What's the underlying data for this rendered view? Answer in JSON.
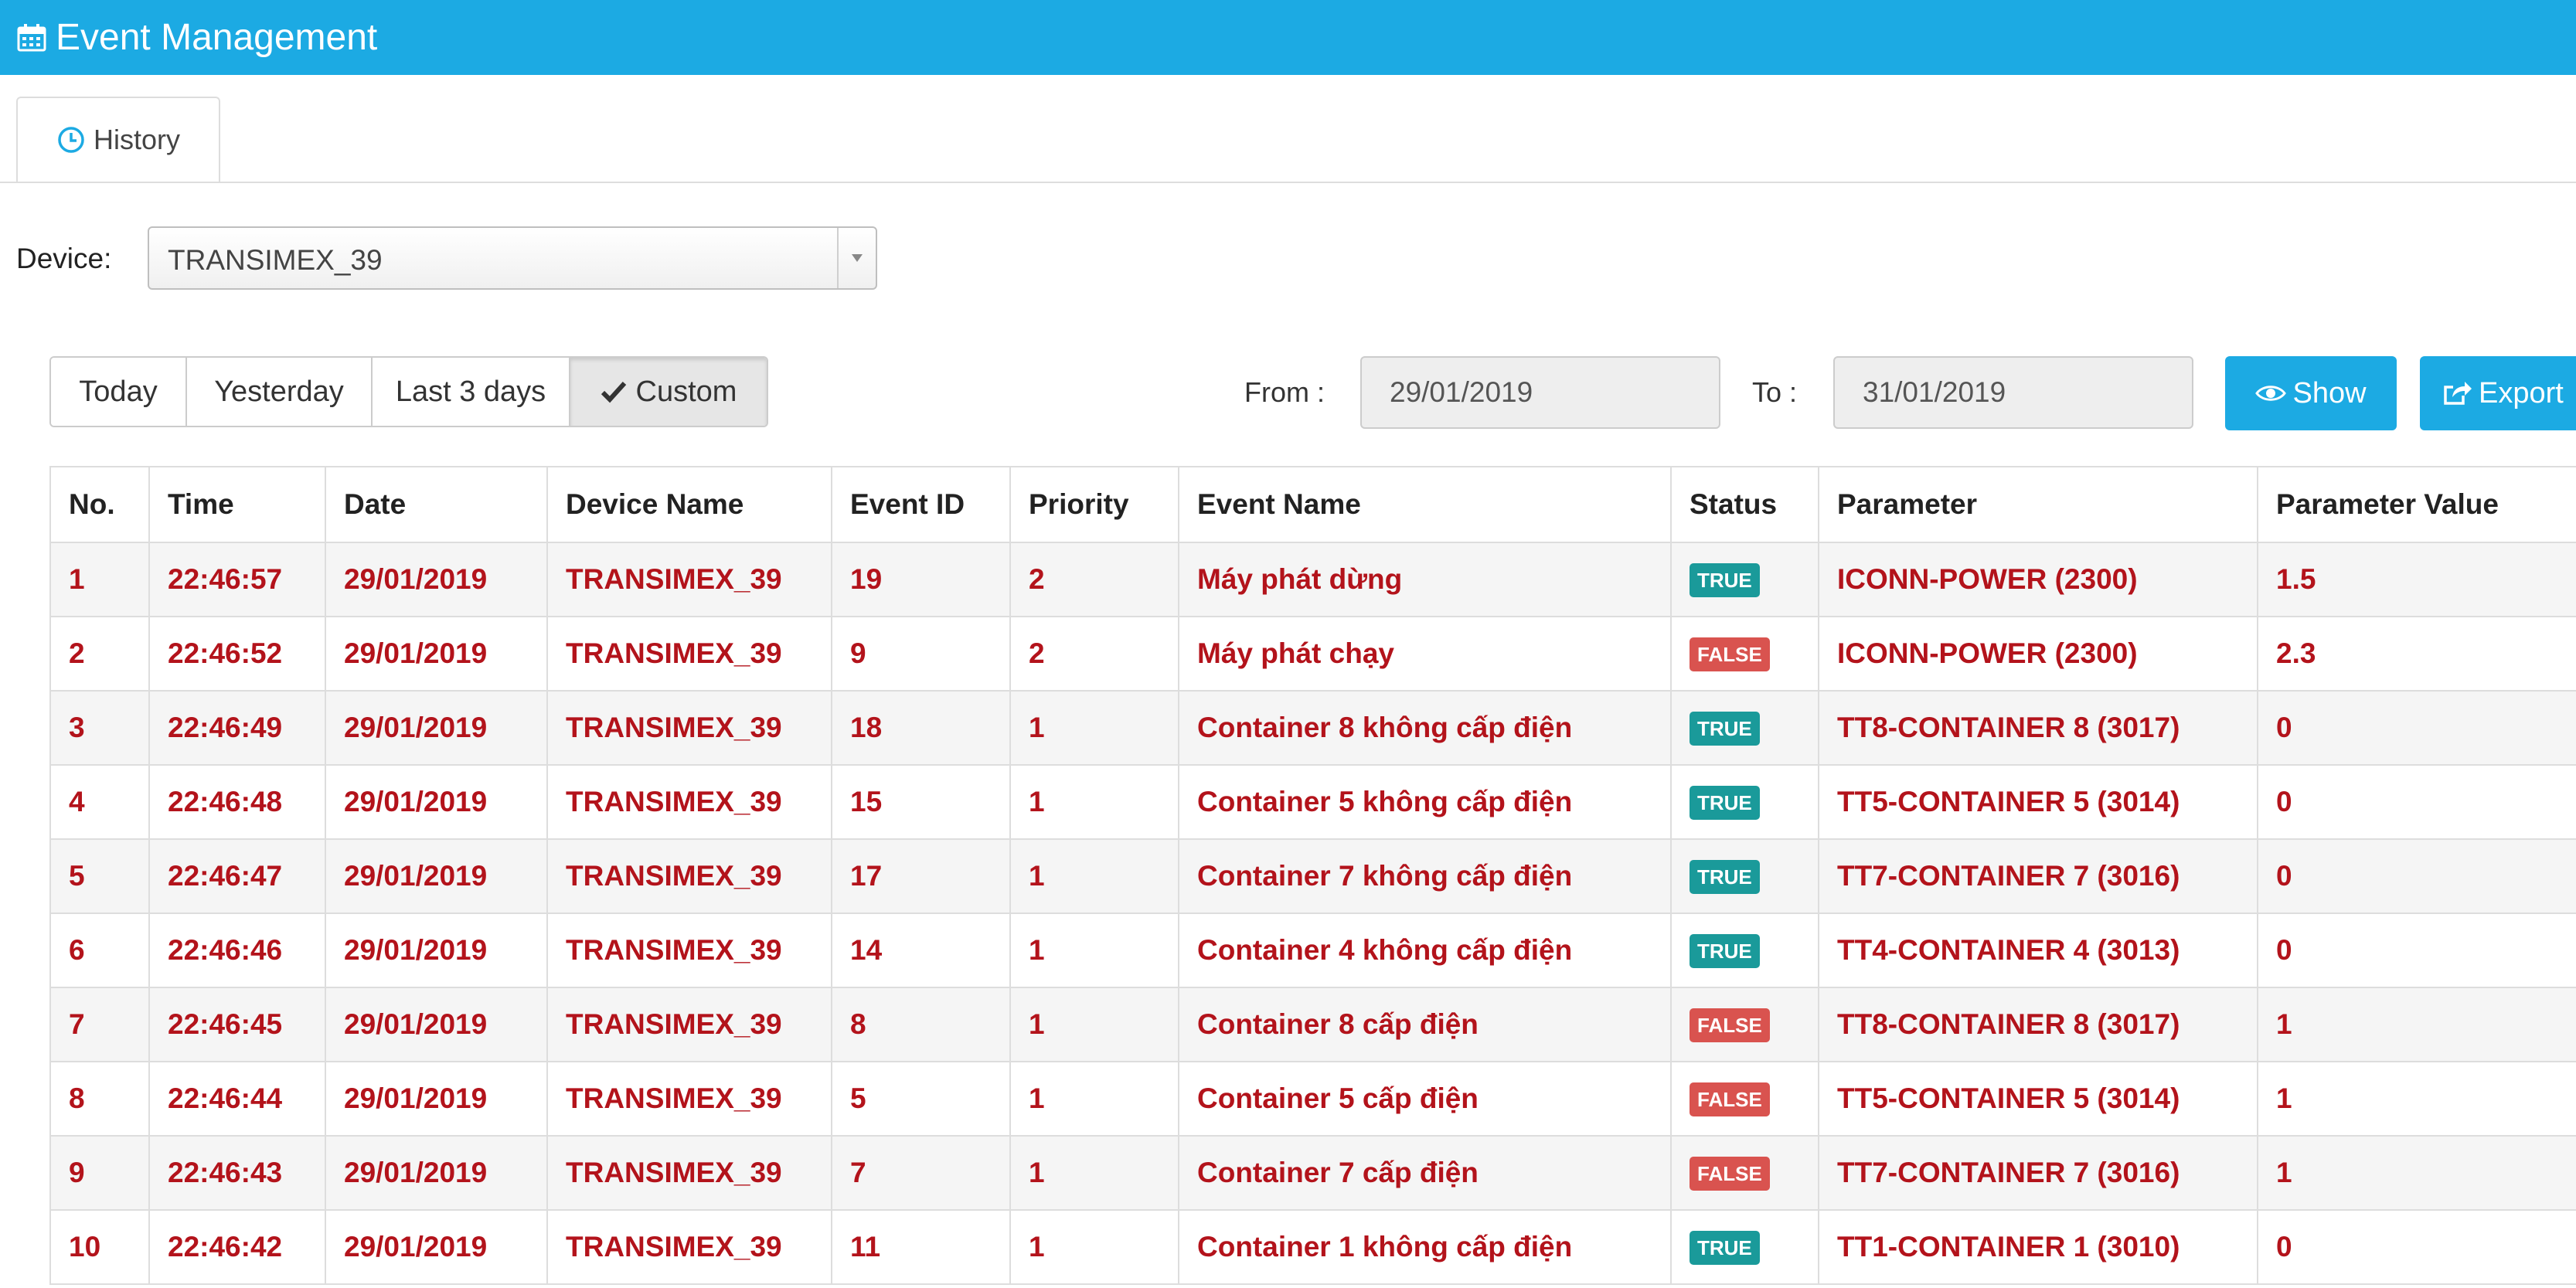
{
  "header": {
    "title": "Event Management",
    "icon": "calendar-icon"
  },
  "tabs": [
    {
      "label": "History",
      "icon": "clock-icon",
      "active": true
    }
  ],
  "device": {
    "label": "Device:",
    "selected": "TRANSIMEX_39"
  },
  "range_buttons": [
    {
      "label": "Today",
      "active": false
    },
    {
      "label": "Yesterday",
      "active": false
    },
    {
      "label": "Last 3 days",
      "active": false
    },
    {
      "label": "Custom",
      "active": true
    }
  ],
  "filter": {
    "from_label": "From :",
    "from_value": "29/01/2019",
    "to_label": "To :",
    "to_value": "31/01/2019",
    "show_label": "Show",
    "export_label": "Export"
  },
  "table": {
    "headers": [
      "No.",
      "Time",
      "Date",
      "Device Name",
      "Event ID",
      "Priority",
      "Event Name",
      "Status",
      "Parameter",
      "Parameter Value"
    ],
    "rows": [
      {
        "no": "1",
        "time": "22:46:57",
        "date": "29/01/2019",
        "device": "TRANSIMEX_39",
        "event_id": "19",
        "priority": "2",
        "event_name": "Máy phát dừng",
        "status": "TRUE",
        "parameter": "ICONN-POWER (2300)",
        "value": "1.5"
      },
      {
        "no": "2",
        "time": "22:46:52",
        "date": "29/01/2019",
        "device": "TRANSIMEX_39",
        "event_id": "9",
        "priority": "2",
        "event_name": "Máy phát chạy",
        "status": "FALSE",
        "parameter": "ICONN-POWER (2300)",
        "value": "2.3"
      },
      {
        "no": "3",
        "time": "22:46:49",
        "date": "29/01/2019",
        "device": "TRANSIMEX_39",
        "event_id": "18",
        "priority": "1",
        "event_name": "Container 8 không cấp điện",
        "status": "TRUE",
        "parameter": "TT8-CONTAINER 8 (3017)",
        "value": "0"
      },
      {
        "no": "4",
        "time": "22:46:48",
        "date": "29/01/2019",
        "device": "TRANSIMEX_39",
        "event_id": "15",
        "priority": "1",
        "event_name": "Container 5 không cấp điện",
        "status": "TRUE",
        "parameter": "TT5-CONTAINER 5 (3014)",
        "value": "0"
      },
      {
        "no": "5",
        "time": "22:46:47",
        "date": "29/01/2019",
        "device": "TRANSIMEX_39",
        "event_id": "17",
        "priority": "1",
        "event_name": "Container 7 không cấp điện",
        "status": "TRUE",
        "parameter": "TT7-CONTAINER 7 (3016)",
        "value": "0"
      },
      {
        "no": "6",
        "time": "22:46:46",
        "date": "29/01/2019",
        "device": "TRANSIMEX_39",
        "event_id": "14",
        "priority": "1",
        "event_name": "Container 4 không cấp điện",
        "status": "TRUE",
        "parameter": "TT4-CONTAINER 4 (3013)",
        "value": "0"
      },
      {
        "no": "7",
        "time": "22:46:45",
        "date": "29/01/2019",
        "device": "TRANSIMEX_39",
        "event_id": "8",
        "priority": "1",
        "event_name": "Container 8 cấp điện",
        "status": "FALSE",
        "parameter": "TT8-CONTAINER 8 (3017)",
        "value": "1"
      },
      {
        "no": "8",
        "time": "22:46:44",
        "date": "29/01/2019",
        "device": "TRANSIMEX_39",
        "event_id": "5",
        "priority": "1",
        "event_name": "Container 5 cấp điện",
        "status": "FALSE",
        "parameter": "TT5-CONTAINER 5 (3014)",
        "value": "1"
      },
      {
        "no": "9",
        "time": "22:46:43",
        "date": "29/01/2019",
        "device": "TRANSIMEX_39",
        "event_id": "7",
        "priority": "1",
        "event_name": "Container 7 cấp điện",
        "status": "FALSE",
        "parameter": "TT7-CONTAINER 7 (3016)",
        "value": "1"
      },
      {
        "no": "10",
        "time": "22:46:42",
        "date": "29/01/2019",
        "device": "TRANSIMEX_39",
        "event_id": "11",
        "priority": "1",
        "event_name": "Container 1 không cấp điện",
        "status": "TRUE",
        "parameter": "TT1-CONTAINER 1 (3010)",
        "value": "0"
      }
    ]
  },
  "colors": {
    "header_bg": "#1caae3",
    "row_text": "#b3131b",
    "badge_true": "#1a9a9a",
    "badge_false": "#d9534f"
  }
}
